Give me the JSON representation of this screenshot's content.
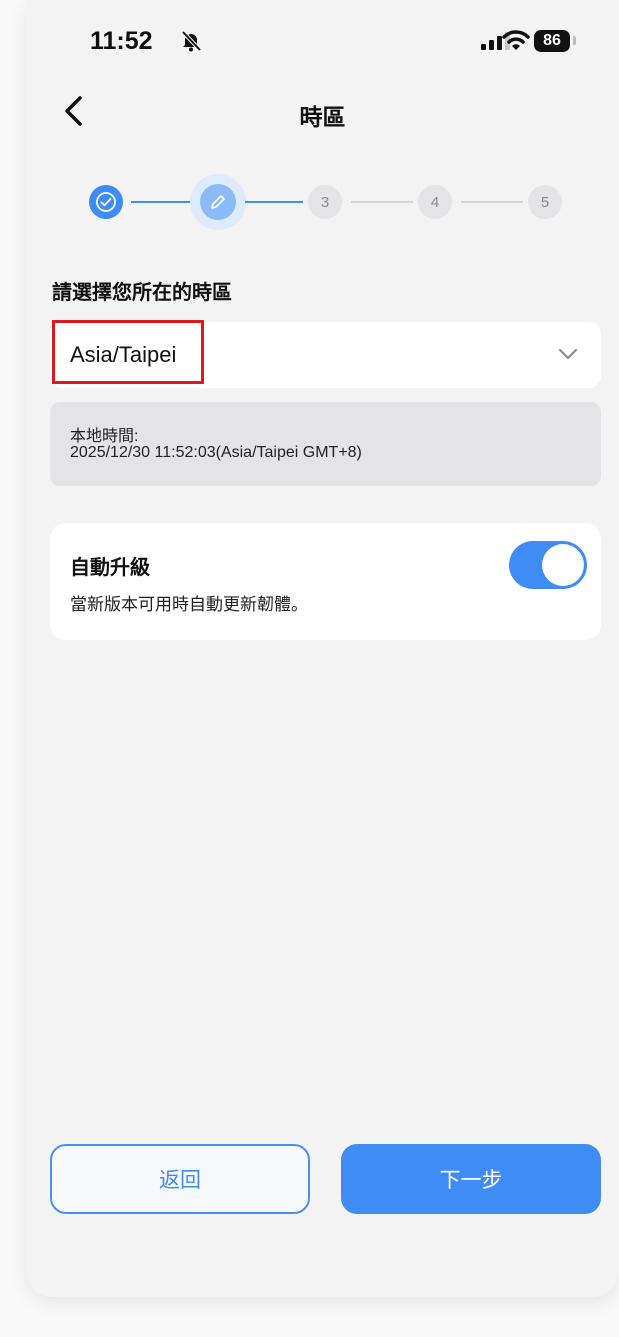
{
  "status_bar": {
    "time": "11:52",
    "battery": "86"
  },
  "header": {
    "title": "時區"
  },
  "stepper": {
    "steps": [
      {
        "label": "",
        "state": "done"
      },
      {
        "label": "",
        "state": "current"
      },
      {
        "label": "3",
        "state": "pending"
      },
      {
        "label": "4",
        "state": "pending"
      },
      {
        "label": "5",
        "state": "pending"
      }
    ]
  },
  "timezone": {
    "label": "請選擇您所在的時區",
    "selected": "Asia/Taipei",
    "local_time_label": "本地時間:",
    "local_time_value": "2025/12/30 11:52:03(Asia/Taipei GMT+8)"
  },
  "auto_upgrade": {
    "title": "自動升級",
    "description": "當新版本可用時自動更新韌體。",
    "enabled": true
  },
  "buttons": {
    "back": "返回",
    "next": "下一步"
  },
  "colors": {
    "accent": "#3f8cf4",
    "highlight": "#e0191f"
  }
}
